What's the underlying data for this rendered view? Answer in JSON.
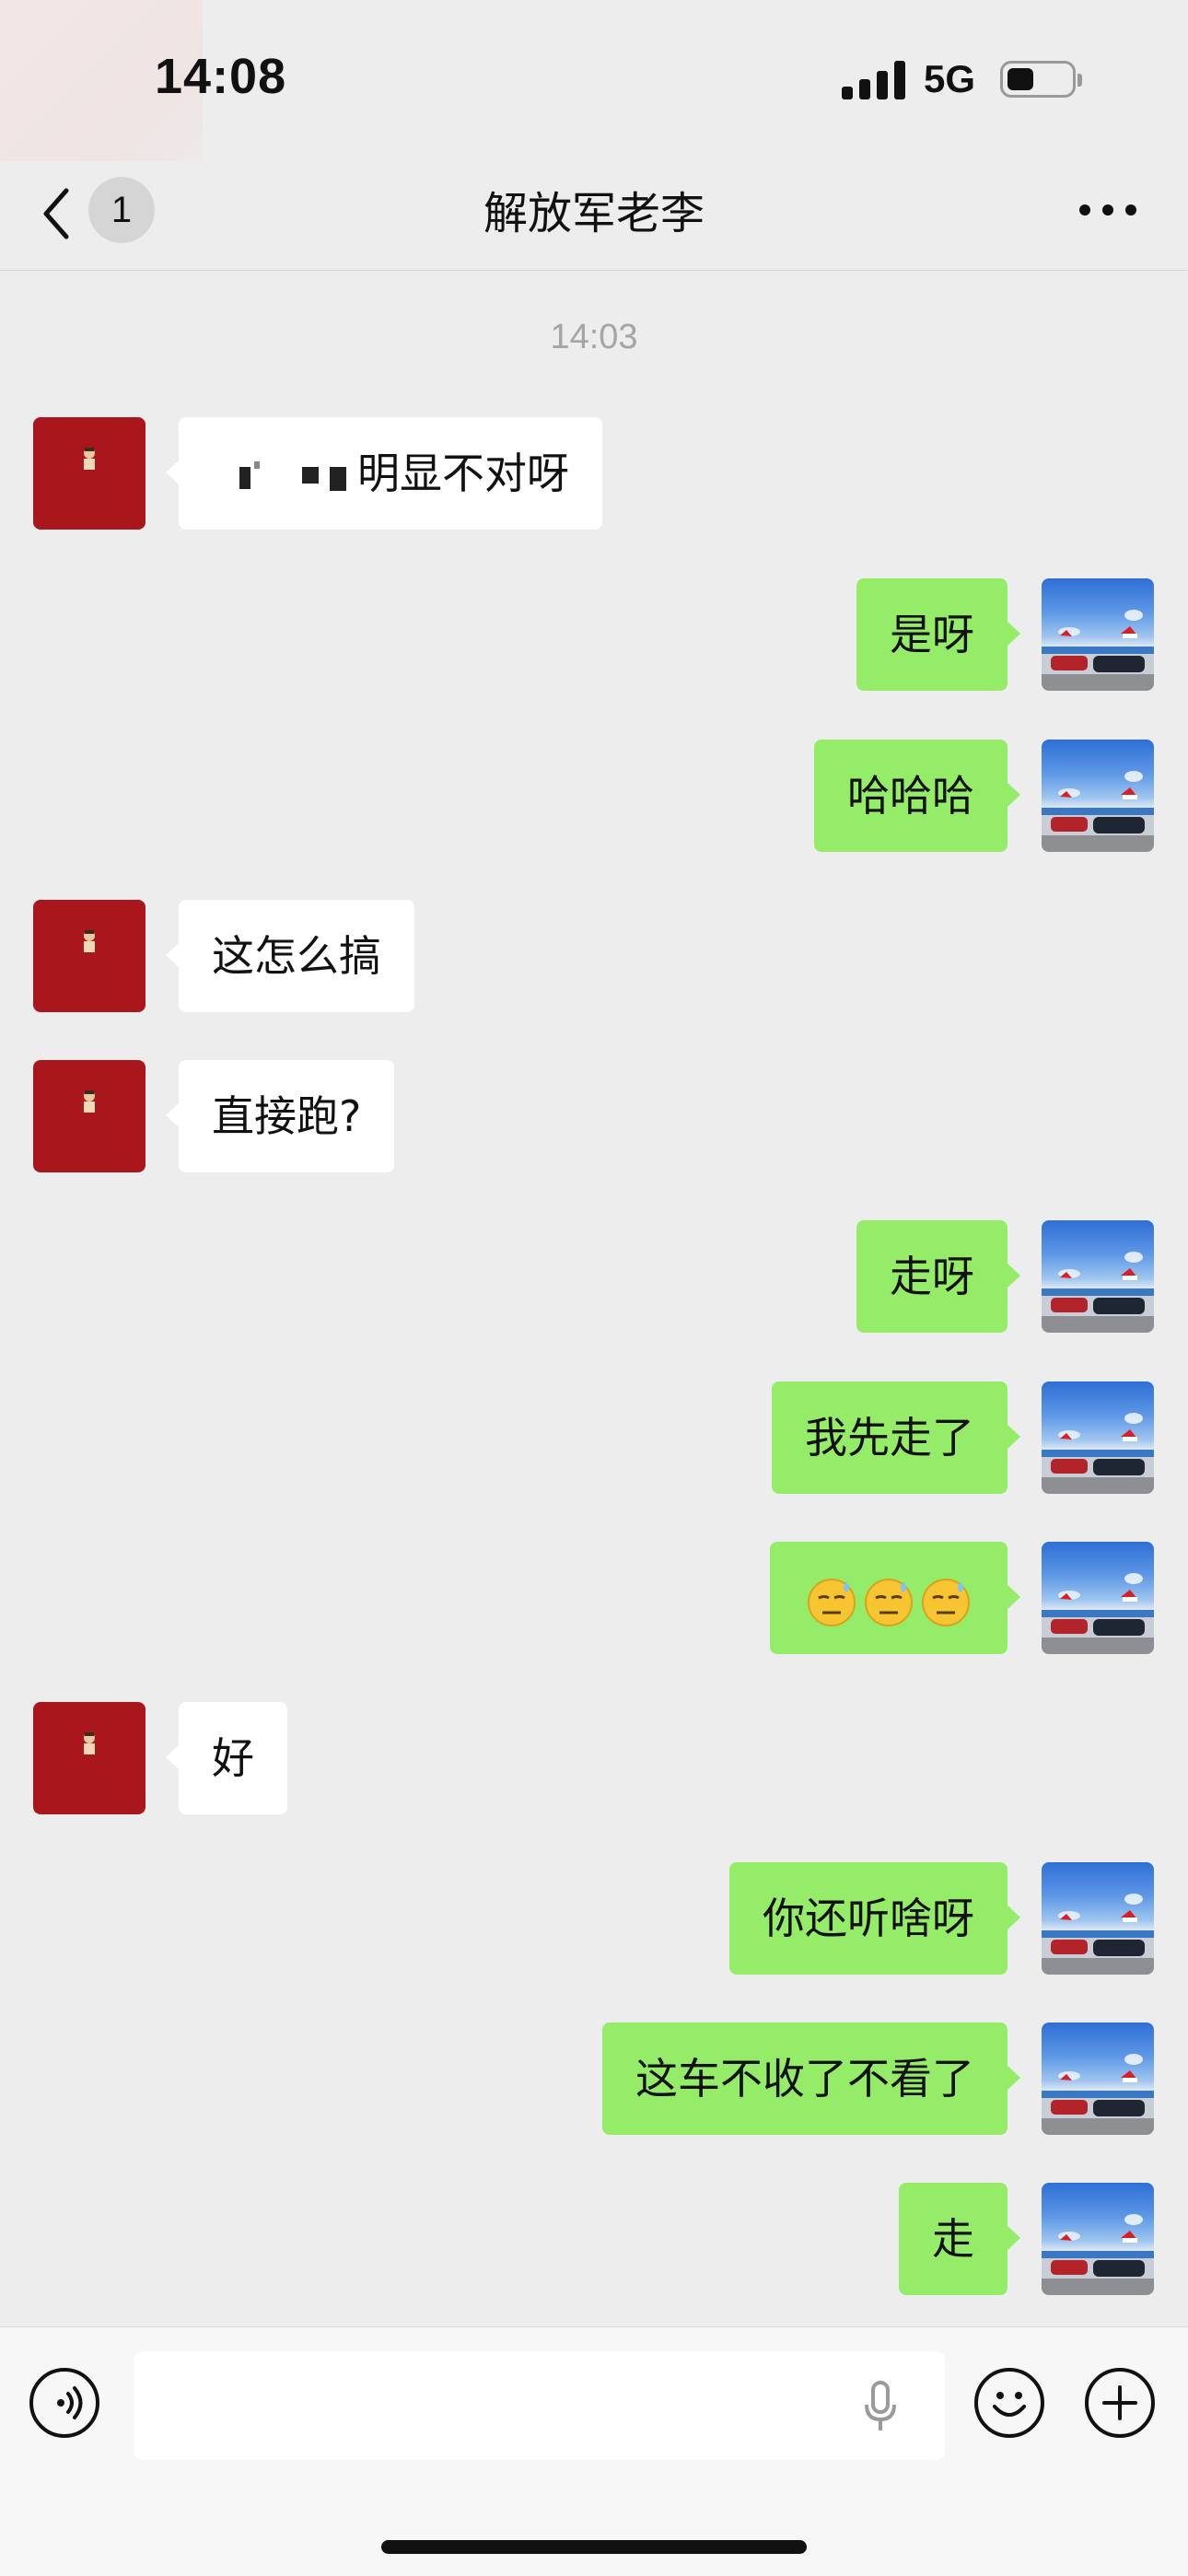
{
  "status_bar": {
    "time": "14:08",
    "network": "5G"
  },
  "nav": {
    "unread_count": "1",
    "title": "解放军老李"
  },
  "timestamp": "14:03",
  "messages": [
    {
      "side": "them",
      "text": "明显不对呀"
    },
    {
      "side": "me",
      "text": "是呀"
    },
    {
      "side": "me",
      "text": "哈哈哈"
    },
    {
      "side": "them",
      "text": "这怎么搞"
    },
    {
      "side": "them",
      "text": "直接跑?"
    },
    {
      "side": "me",
      "text": "走呀"
    },
    {
      "side": "me",
      "text": "我先走了"
    },
    {
      "side": "me",
      "text": ""
    },
    {
      "side": "them",
      "text": "好"
    },
    {
      "side": "me",
      "text": "你还听啥呀"
    },
    {
      "side": "me",
      "text": "这车不收了不看了"
    },
    {
      "side": "me",
      "text": "走"
    }
  ],
  "icons": {
    "back": "chevron-left-icon",
    "more": "more-dots-icon",
    "voice": "voice-icon",
    "mic": "mic-icon",
    "emoji": "emoji-icon",
    "plus": "plus-icon",
    "sweat_emoji": "sweat-emoji-icon"
  },
  "colors": {
    "my_bubble": "#95ec69",
    "their_bubble": "#ffffff",
    "their_avatar": "#a9161b",
    "background": "#ededed"
  }
}
